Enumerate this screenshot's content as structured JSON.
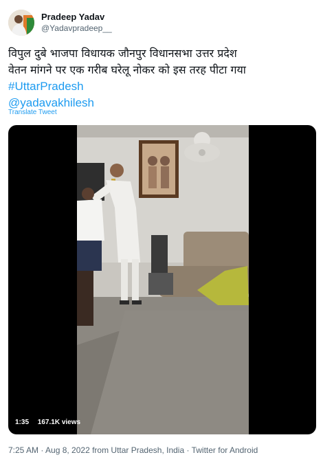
{
  "author": {
    "display_name": "Pradeep Yadav",
    "handle": "@Yadavpradeep__"
  },
  "tweet": {
    "line1": "विपुल दुबे भाजपा विधायक जौनपुर विधानसभा उत्तर प्रदेश",
    "line2": "वेतन मांगने पर एक गरीब घरेलू नोकर को इस तरह पीटा गया",
    "hashtag": "#UttarPradesh",
    "mention": "@yadavakhilesh",
    "translate_label": "Translate Tweet"
  },
  "video": {
    "duration": "1:35",
    "views": "167.1K views"
  },
  "footer": {
    "timestamp": "7:25 AM · Aug 8, 2022 from Uttar Pradesh, India · Twitter for Android"
  },
  "colors": {
    "link": "#1d9bf0",
    "secondary_text": "#536471"
  }
}
